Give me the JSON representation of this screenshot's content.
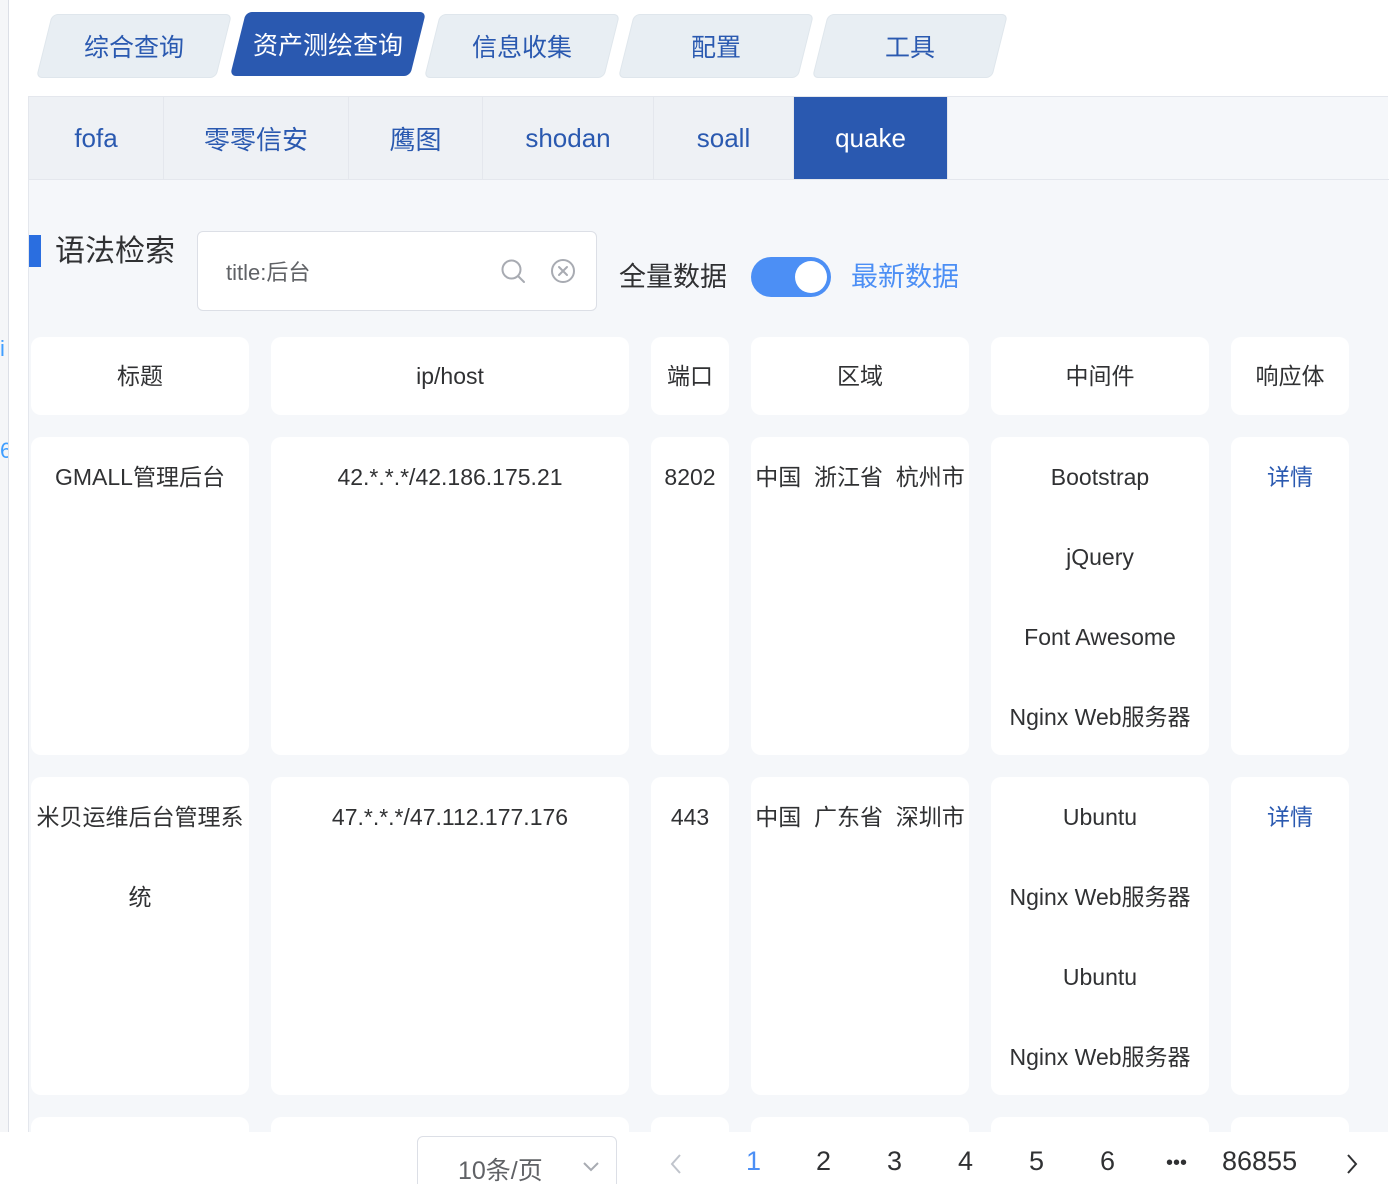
{
  "top_tabs": [
    {
      "label": "综合查询",
      "active": false
    },
    {
      "label": "资产测绘查询",
      "active": true
    },
    {
      "label": "信息收集",
      "active": false
    },
    {
      "label": "配置",
      "active": false
    },
    {
      "label": "工具",
      "active": false
    }
  ],
  "sub_tabs": [
    {
      "label": "fofa",
      "active": false
    },
    {
      "label": "零零信安",
      "active": false
    },
    {
      "label": "鹰图",
      "active": false
    },
    {
      "label": "shodan",
      "active": false
    },
    {
      "label": "soall",
      "active": false
    },
    {
      "label": "quake",
      "active": true
    }
  ],
  "search": {
    "label": "语法检索",
    "value": "title:后台",
    "full_data_label": "全量数据",
    "latest_data_label": "最新数据",
    "toggle_on": true
  },
  "table": {
    "headers": [
      "标题",
      "ip/host",
      "端口",
      "区域",
      "中间件",
      "响应体"
    ],
    "rows": [
      {
        "title_lines": [
          "GMALL管理后台"
        ],
        "host": "42.*.*.*/42.186.175.21",
        "port": "8202",
        "region": "中国  浙江省  杭州市",
        "middleware": [
          "Bootstrap",
          "jQuery",
          "Font Awesome",
          "Nginx Web服务器"
        ],
        "action": "详情"
      },
      {
        "title_lines": [
          "米贝运维后台管理系",
          "统"
        ],
        "host": "47.*.*.*/47.112.177.176",
        "port": "443",
        "region": "中国  广东省  深圳市",
        "middleware": [
          "Ubuntu",
          "Nginx Web服务器",
          "Ubuntu",
          "Nginx Web服务器"
        ],
        "action": "详情"
      }
    ]
  },
  "pagination": {
    "page_size": "10条/页",
    "pages": [
      "1",
      "2",
      "3",
      "4",
      "5",
      "6"
    ],
    "current": "1",
    "ellipsis": "•••",
    "last_page": "86855"
  },
  "colors": {
    "primary": "#2a59b0",
    "accent": "#4c8ff5"
  }
}
